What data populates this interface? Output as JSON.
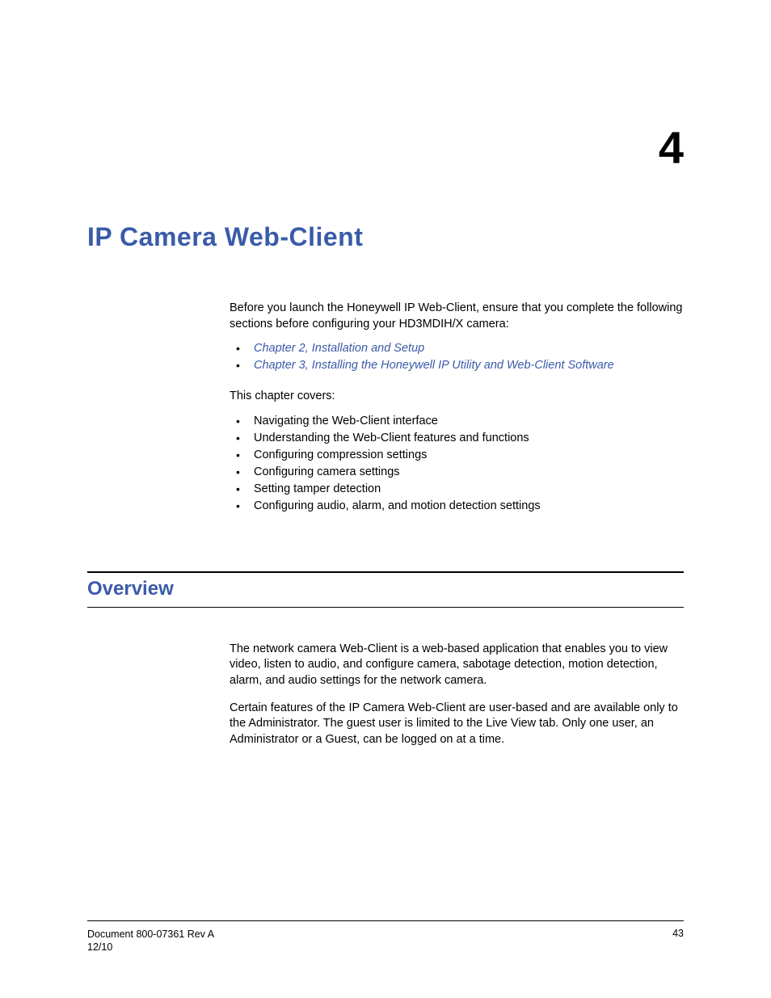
{
  "chapter": {
    "number": "4",
    "title": "IP Camera Web-Client"
  },
  "intro": {
    "lead": "Before you launch the Honeywell IP Web-Client, ensure that you complete the following sections before configuring your HD3MDIH/X camera:",
    "links": [
      "Chapter 2, Installation and Setup",
      "Chapter 3, Installing the Honeywell IP Utility and Web-Client Software"
    ],
    "covers_lead": "This chapter covers:",
    "covers": [
      "Navigating the Web-Client interface",
      "Understanding the Web-Client features and functions",
      "Configuring compression settings",
      "Configuring camera settings",
      "Setting tamper detection",
      "Configuring audio, alarm, and motion detection settings"
    ]
  },
  "overview": {
    "heading": "Overview",
    "p1": "The network camera Web-Client is a web-based application that enables you to view video, listen to audio, and configure camera, sabotage detection, motion detection, alarm, and audio settings for the network camera.",
    "p2": "Certain features of the IP Camera Web-Client are user-based and are available only to the Administrator. The guest user is limited to the Live View tab. Only one user, an Administrator or a Guest, can be logged on at a time."
  },
  "footer": {
    "doc": "Document 800-07361 Rev A",
    "date": "12/10",
    "page": "43"
  }
}
